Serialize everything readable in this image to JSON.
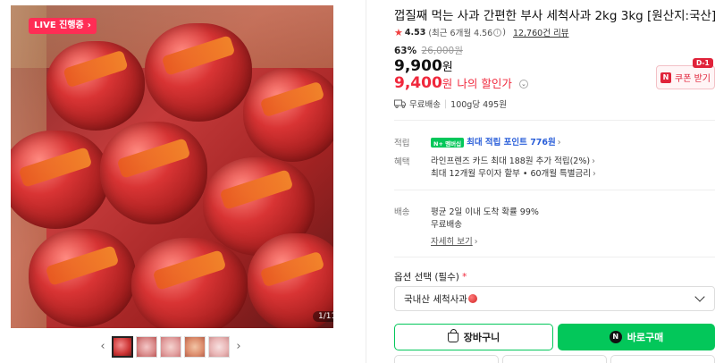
{
  "gallery": {
    "live_badge": "LIVE 진행중",
    "counter": "1/11",
    "prev_icon": "chevron-left-icon",
    "next_icon": "chevron-right-icon"
  },
  "product": {
    "title": "껍질째 먹는 사과 간편한 부사 세척사과 2kg 3kg [원산지:국산]",
    "rating": "4.53",
    "recent_rating": "(최근 6개월 4.56",
    "recent_rating_close": ")",
    "review_count": "12,760건 리뷰"
  },
  "price": {
    "discount_rate": "63%",
    "original": "26,000원",
    "sale": "9,900",
    "sale_unit": "원",
    "my_price": "9,400",
    "my_price_unit": "원",
    "my_price_label": "나의 할인가",
    "coupon_label": "쿠폰 받기",
    "coupon_dday": "D-1"
  },
  "shipping_summary": {
    "free": "무료배송",
    "unit_price": "100g당 495원"
  },
  "benefits": {
    "points_label": "적립",
    "npay_badge": "N+ 멤버십",
    "points_text": "최대 적립 포인트 776원",
    "benefit_label": "혜택",
    "benefit_line1": "라인프렌즈 카드 최대 188원 추가 적립(2%)",
    "benefit_line2": "최대 12개월 무이자 할부 • 60개월 특별금리"
  },
  "delivery": {
    "label": "배송",
    "arrival": "평균 2일 이내 도착 확률 99%",
    "fee": "무료배송",
    "more_link": "자세히 보기"
  },
  "options": {
    "label": "옵션 선택 (필수)",
    "required_mark": "*",
    "selected": "국내산 세척사과"
  },
  "actions": {
    "cart": "장바구니",
    "buy": "바로구매"
  },
  "colors": {
    "naver_green": "#03c75a",
    "sale_red": "#f0283c",
    "link_blue": "#2b5fd9"
  }
}
